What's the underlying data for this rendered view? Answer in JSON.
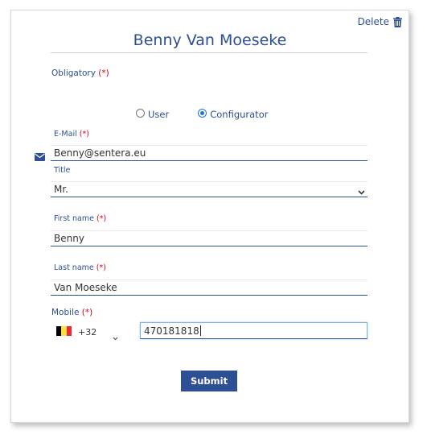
{
  "header": {
    "delete_label": "Delete",
    "title": "Benny Van Moeseke"
  },
  "form": {
    "obligatory_label": "Obligatory",
    "required_mark": "(*)",
    "role_options": [
      {
        "label": "User",
        "selected": false
      },
      {
        "label": "Configurator",
        "selected": true
      }
    ],
    "email": {
      "label": "E-Mail",
      "value": "Benny@sentera.eu",
      "icon": "envelope-icon"
    },
    "title_field": {
      "label": "Title",
      "value": "Mr."
    },
    "first_name": {
      "label": "First name",
      "value": "Benny"
    },
    "last_name": {
      "label": "Last name",
      "value": "Van Moeseke"
    },
    "mobile": {
      "label": "Mobile",
      "country_flag": "belgium-flag",
      "dial_code": "+32",
      "number": "470181818"
    },
    "submit_label": "Submit"
  },
  "colors": {
    "accent": "#2d4f93",
    "required": "#d0021b",
    "flag": [
      "#000000",
      "#fae042",
      "#ed2939"
    ]
  }
}
